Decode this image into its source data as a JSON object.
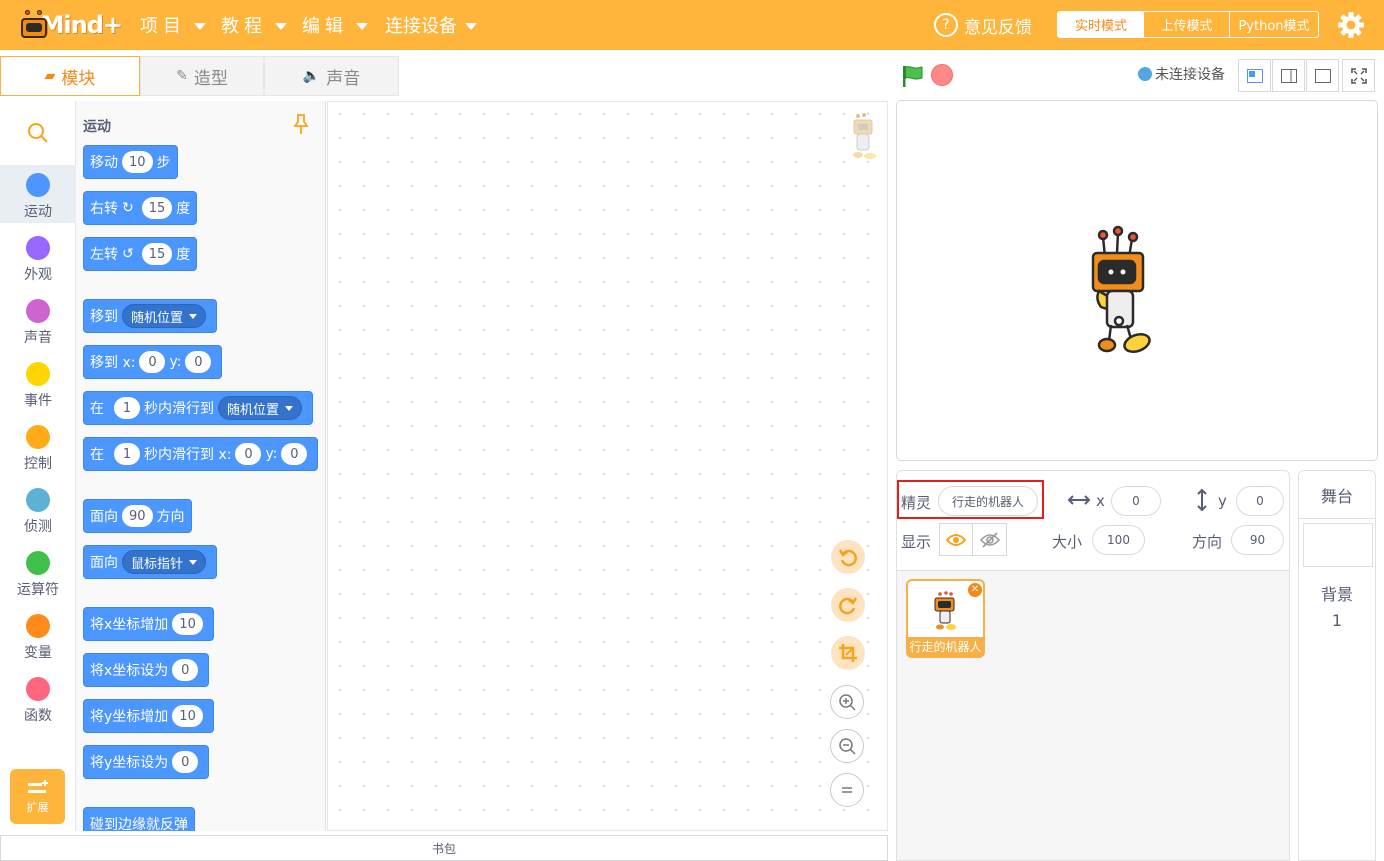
{
  "app": {
    "logo_text": "Mind+",
    "menus": [
      {
        "label": "项目"
      },
      {
        "label": "教程"
      },
      {
        "label": "编辑"
      },
      {
        "label": "连接设备"
      }
    ],
    "feedback": "意见反馈",
    "modes": [
      "实时模式",
      "上传模式",
      "Python模式"
    ],
    "active_mode": "实时模式"
  },
  "tabs": [
    {
      "label": "模块",
      "icon": "blocks-icon",
      "active": true
    },
    {
      "label": "造型",
      "icon": "brush-icon",
      "active": false
    },
    {
      "label": "声音",
      "icon": "speaker-icon",
      "active": false
    }
  ],
  "device_status": "未连接设备",
  "categories": [
    {
      "label": "运动",
      "color": "#4c97ff"
    },
    {
      "label": "外观",
      "color": "#9966ff"
    },
    {
      "label": "声音",
      "color": "#cf63cf"
    },
    {
      "label": "事件",
      "color": "#ffd500"
    },
    {
      "label": "控制",
      "color": "#ffab19"
    },
    {
      "label": "侦测",
      "color": "#5cb1d6"
    },
    {
      "label": "运算符",
      "color": "#40bf4a"
    },
    {
      "label": "变量",
      "color": "#ff8c1a"
    },
    {
      "label": "函数",
      "color": "#ff6680"
    }
  ],
  "extension_label": "扩展",
  "flyout": {
    "title": "运动",
    "blocks": {
      "move": {
        "t1": "移动",
        "v1": "10",
        "t2": "步"
      },
      "turn_right": {
        "t1": "右转",
        "v1": "15",
        "t2": "度"
      },
      "turn_left": {
        "t1": "左转",
        "v1": "15",
        "t2": "度"
      },
      "goto": {
        "t1": "移到",
        "d1": "随机位置"
      },
      "goto_xy": {
        "t1": "移到 x:",
        "v1": "0",
        "t2": "y:",
        "v2": "0"
      },
      "glide_to": {
        "t1": "在",
        "v1": "1",
        "t2": "秒内滑行到",
        "d1": "随机位置"
      },
      "glide_xy": {
        "t1": "在",
        "v1": "1",
        "t2": "秒内滑行到 x:",
        "v2": "0",
        "t3": "y:",
        "v3": "0"
      },
      "point_dir": {
        "t1": "面向",
        "v1": "90",
        "t2": "方向"
      },
      "point_towards": {
        "t1": "面向",
        "d1": "鼠标指针"
      },
      "change_x": {
        "t1": "将x坐标增加",
        "v1": "10"
      },
      "set_x": {
        "t1": "将x坐标设为",
        "v1": "0"
      },
      "change_y": {
        "t1": "将y坐标增加",
        "v1": "10"
      },
      "set_y": {
        "t1": "将y坐标设为",
        "v1": "0"
      },
      "bounce": {
        "t1": "碰到边缘就反弹"
      }
    }
  },
  "backpack": "书包",
  "sprite_info": {
    "sprite_label": "精灵",
    "sprite_name": "行走的机器人",
    "x_label": "x",
    "x_value": "0",
    "y_label": "y",
    "y_value": "0",
    "show_label": "显示",
    "size_label": "大小",
    "size_value": "100",
    "direction_label": "方向",
    "direction_value": "90"
  },
  "sprites": [
    {
      "name": "行走的机器人"
    }
  ],
  "stage_panel": {
    "title": "舞台",
    "backdrop_label": "背景",
    "backdrop_count": "1"
  },
  "colors": {
    "topbar": "#ffb43c",
    "motion": "#4c97ff",
    "highlight_box": "#e0201c"
  }
}
